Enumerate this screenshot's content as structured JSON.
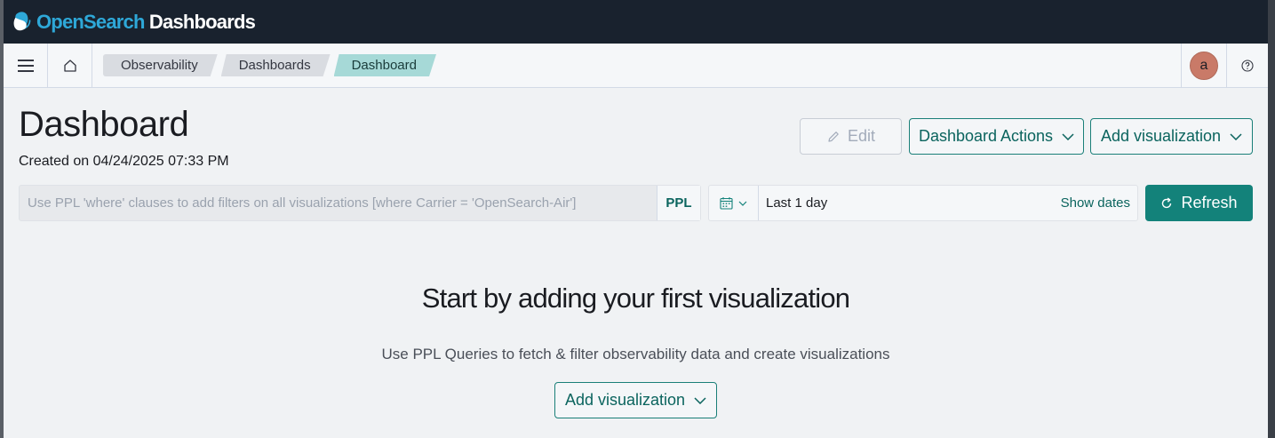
{
  "app": {
    "brand_prefix": "OpenSearch",
    "brand_suffix": " Dashboards",
    "logo_icon": "opensearch-logo-icon"
  },
  "nav": {
    "menu_icon": "hamburger-icon",
    "home_icon": "home-icon",
    "breadcrumbs": [
      {
        "label": "Observability"
      },
      {
        "label": "Dashboards"
      },
      {
        "label": "Dashboard"
      }
    ],
    "avatar_initial": "a",
    "help_icon": "help-icon"
  },
  "header": {
    "title": "Dashboard",
    "created": "Created on 04/24/2025 07:33 PM",
    "edit_label": "Edit",
    "actions_label": "Dashboard Actions",
    "add_vis_label": "Add visualization"
  },
  "filters": {
    "placeholder": "Use PPL 'where' clauses to add filters on all visualizations [where Carrier = 'OpenSearch-Air']",
    "language": "PPL",
    "date_icon": "calendar-icon",
    "date_range": "Last 1 day",
    "show_dates": "Show dates",
    "refresh_label": "Refresh"
  },
  "empty_state": {
    "title": "Start by adding your first visualization",
    "subtitle": "Use PPL Queries to fetch & filter observability data and create visualizations",
    "button_label": "Add visualization"
  },
  "colors": {
    "header_bg": "#19222e",
    "accent": "#13827a",
    "link": "#0b645e",
    "breadcrumb_active": "#a6d9d7",
    "avatar": "#c97a68"
  }
}
